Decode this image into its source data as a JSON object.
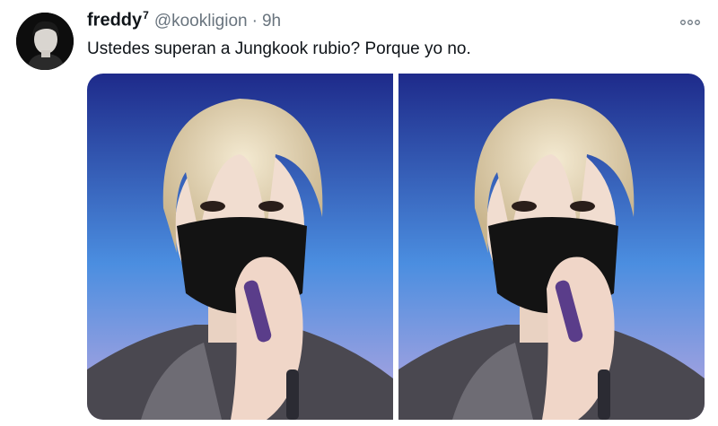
{
  "tweet": {
    "display_name": "freddy",
    "name_badge": "7",
    "handle": "@kookligion",
    "separator": "·",
    "time": "9h",
    "text": "Ustedes superan a Jungkook rubio? Porque yo no."
  },
  "icons": {
    "more": "more-horizontal-icon"
  },
  "colors": {
    "text_primary": "#0f1419",
    "text_secondary": "#69747e",
    "photo_bg_top": "#1e2a8a",
    "photo_bg_bottom": "#b9a7e0"
  }
}
